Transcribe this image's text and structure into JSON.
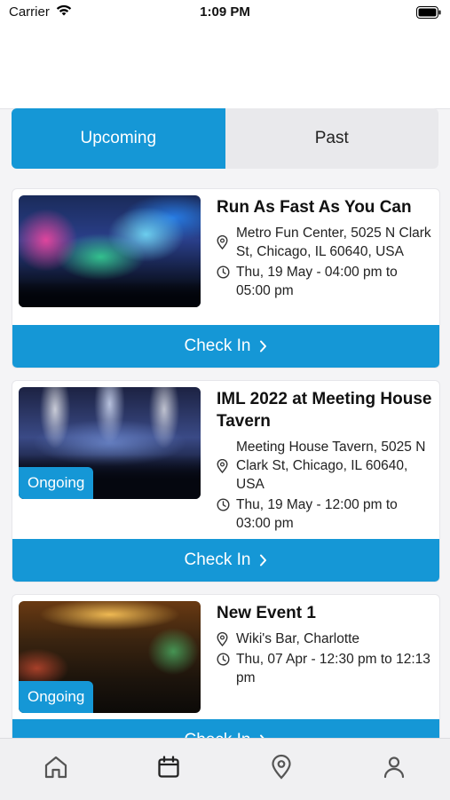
{
  "status_bar": {
    "carrier": "Carrier",
    "time": "1:09 PM"
  },
  "tabs": [
    {
      "label": "Upcoming",
      "active": true
    },
    {
      "label": "Past",
      "active": false
    }
  ],
  "events": [
    {
      "title": "Run As Fast As You Can",
      "location": "Metro Fun Center, 5025 N Clark St, Chicago, IL 60640, USA",
      "time": "Thu, 19 May - 04:00 pm to 05:00 pm",
      "badge": "",
      "button": "Check In"
    },
    {
      "title": "IML 2022 at Meeting House Tavern",
      "location": "Meeting House Tavern, 5025 N Clark St, Chicago, IL 60640, USA",
      "time": "Thu, 19 May - 12:00 pm to 03:00 pm",
      "badge": "Ongoing",
      "button": "Check In"
    },
    {
      "title": "New Event 1",
      "location": "Wiki's Bar, Charlotte",
      "time": "Thu, 07 Apr - 12:30 pm to 12:13 pm",
      "badge": "Ongoing",
      "button": "Check In"
    }
  ],
  "colors": {
    "accent": "#1597d6",
    "tab_inactive": "#e9e9ec",
    "background": "#f4f4f6"
  },
  "bottom_nav": [
    {
      "icon": "home-icon"
    },
    {
      "icon": "calendar-icon"
    },
    {
      "icon": "location-pin-icon"
    },
    {
      "icon": "profile-icon"
    }
  ]
}
